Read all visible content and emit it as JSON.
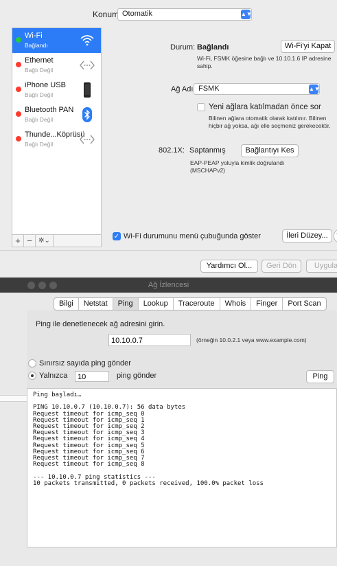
{
  "network_prefs": {
    "location_label": "Konum:",
    "location_value": "Otomatik",
    "services": [
      {
        "name": "Wi-Fi",
        "status": "Bağlandı",
        "status_color": "#28c840",
        "icon": "wifi-icon",
        "selected": true
      },
      {
        "name": "Ethernet",
        "status": "Bağlı Değil",
        "status_color": "#ff3b30",
        "icon": "ethernet-icon",
        "selected": false
      },
      {
        "name": "iPhone USB",
        "status": "Bağlı Değil",
        "status_color": "#ff3b30",
        "icon": "iphone-icon",
        "selected": false
      },
      {
        "name": "Bluetooth PAN",
        "status": "Bağlı Değil",
        "status_color": "#ff3b30",
        "icon": "bluetooth-icon",
        "selected": false
      },
      {
        "name": "Thunde...Köprüsü",
        "status": "Bağlı Değil",
        "status_color": "#ff3b30",
        "icon": "thunderbolt-bridge-icon",
        "selected": false
      }
    ],
    "toolbar": {
      "add": "+",
      "remove": "−",
      "action": "✲⌄"
    },
    "status_label": "Durum:",
    "status_value": "Bağlandı",
    "turn_off_button": "Wi-Fi'yi Kapat",
    "status_desc": "Wi-Fi, FSMK öğesine bağlı ve 10.10.1.6 IP adresine sahip.",
    "network_name_label": "Ağ Adı:",
    "network_name_value": "FSMK",
    "ask_join_label": "Yeni ağlara katılmadan önce sor",
    "ask_join_checked": false,
    "ask_join_desc": "Bilinen ağlara otomatik olarak katılınır. Bilinen hiçbir ağ yoksa, ağı elle seçmeniz gerekecektir.",
    "dot1x_label": "802.1X:",
    "dot1x_value": "Saptanmış",
    "disconnect_button": "Bağlantıyı Kes",
    "dot1x_desc": "EAP-PEAP yoluyla kimlik doğrulandı (MSCHAPv2)",
    "show_menu_label": "Wi-Fi durumunu menü çubuğunda göster",
    "show_menu_checked": true,
    "advanced_button": "İleri Düzey...",
    "help_button": "?",
    "assist_button": "Yardımcı Ol...",
    "revert_button": "Geri Dön",
    "apply_button": "Uygula",
    "accent_color": "#2b7cf6"
  },
  "network_utility": {
    "window_title": "Ağ İzlencesi",
    "tabs": [
      "Bilgi",
      "Netstat",
      "Ping",
      "Lookup",
      "Traceroute",
      "Whois",
      "Finger",
      "Port Scan"
    ],
    "active_tab": "Ping",
    "prompt": "Ping ile denetlenecek ağ adresini girin.",
    "address_value": "10.10.0.7",
    "address_example": "(örneğin 10.0.2.1 veya www.example.com)",
    "unlimited_label": "Sınırsız sayıda ping gönder",
    "only_label": "Yalnızca",
    "count_value": "10",
    "send_suffix": "ping gönder",
    "ping_button": "Ping",
    "output_lines": [
      "Ping başladı…",
      "",
      "PING 10.10.0.7 (10.10.0.7): 56 data bytes",
      "Request timeout for icmp_seq 0",
      "Request timeout for icmp_seq 1",
      "Request timeout for icmp_seq 2",
      "Request timeout for icmp_seq 3",
      "Request timeout for icmp_seq 4",
      "Request timeout for icmp_seq 5",
      "Request timeout for icmp_seq 6",
      "Request timeout for icmp_seq 7",
      "Request timeout for icmp_seq 8",
      "",
      "--- 10.10.0.7 ping statistics ---",
      "10 packets transmitted, 0 packets received, 100.0% packet loss"
    ]
  }
}
